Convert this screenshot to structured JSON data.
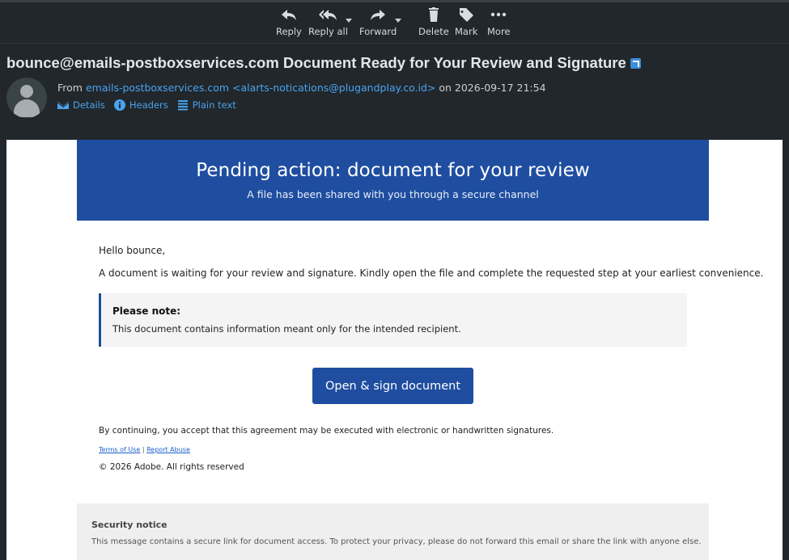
{
  "toolbar": {
    "reply": "Reply",
    "reply_all": "Reply all",
    "forward": "Forward",
    "delete": "Delete",
    "mark": "Mark",
    "more": "More"
  },
  "header": {
    "subject": "bounce@emails-postboxservices.com Document Ready for Your Review and Signature",
    "from_prefix": "From",
    "sender_name": "emails-postboxservices.com",
    "sender_email": "<alarts-notications@plugandplay.co.id>",
    "date_prefix": "on",
    "date": "2026-09-17 21:54",
    "links": {
      "details": "Details",
      "headers": "Headers",
      "plain_text": "Plain text"
    }
  },
  "email": {
    "banner_title": "Pending action: document for your review",
    "banner_subtitle": "A file has been shared with you through a secure channel",
    "greeting": "Hello bounce,",
    "intro": "A document is waiting for your review and signature. Kindly open the file and complete the requested step at your earliest convenience.",
    "note_title": "Please note:",
    "note_body": "This document contains information meant only for the intended recipient.",
    "cta": "Open & sign document",
    "consent": "By continuing, you accept that this agreement may be executed with electronic or handwritten signatures.",
    "terms": "Terms of Use",
    "separator": "|",
    "report": "Report Abuse",
    "copyright": "© 2026 Adobe. All rights reserved",
    "security_title": "Security notice",
    "security_body": "This message contains a secure link for document access. To protect your privacy, please do not forward this email or share the link with anyone else."
  },
  "colors": {
    "accent": "#1f4ea0",
    "link": "#4aa3f0",
    "background": "#21272b"
  }
}
